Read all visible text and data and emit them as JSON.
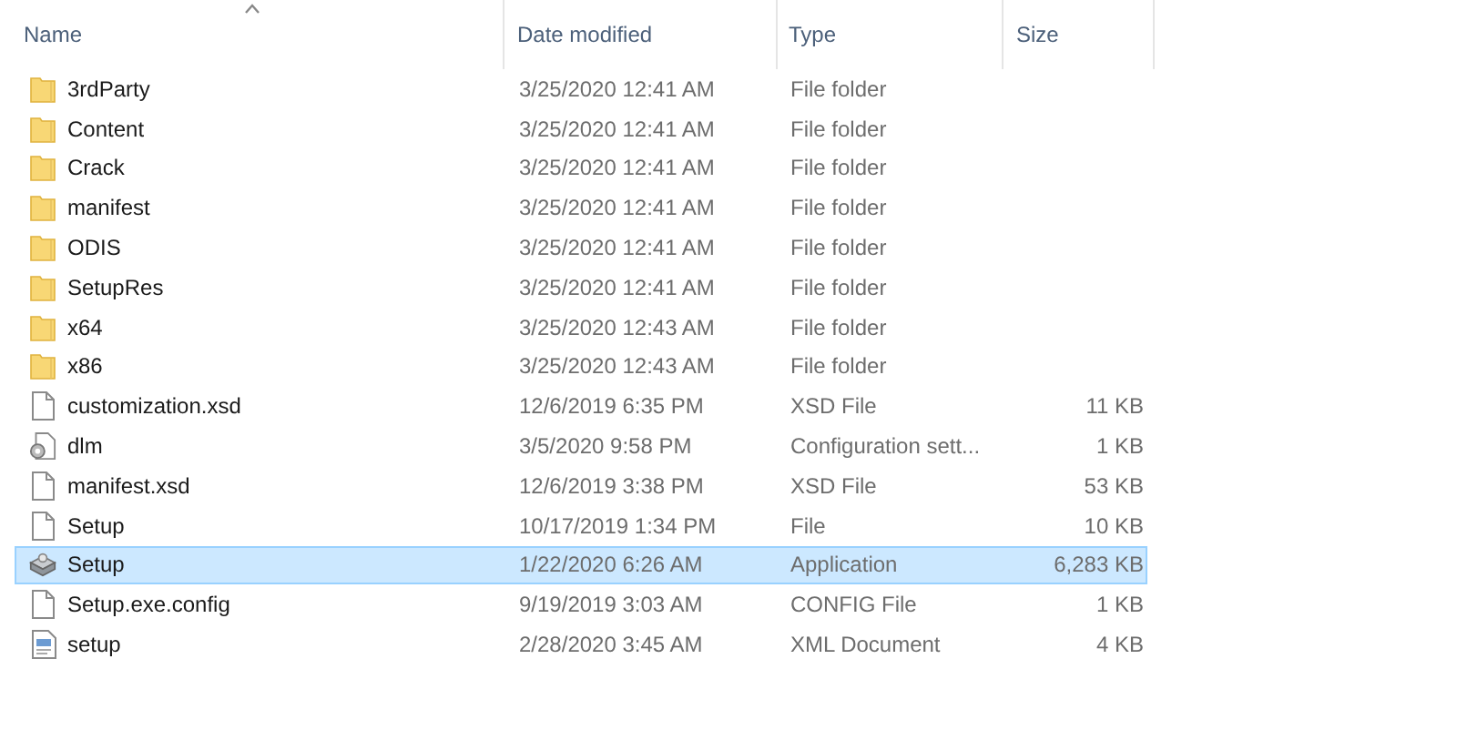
{
  "columns": [
    {
      "label": "Name",
      "sorted": true
    },
    {
      "label": "Date modified",
      "sorted": false
    },
    {
      "label": "Type",
      "sorted": false
    },
    {
      "label": "Size",
      "sorted": false
    }
  ],
  "rows": [
    {
      "kind": "folder",
      "name": "3rdParty",
      "date": "3/25/2020 12:41 AM",
      "type": "File folder",
      "selected": false
    },
    {
      "kind": "folder",
      "name": "Content",
      "date": "3/25/2020 12:41 AM",
      "type": "File folder",
      "selected": false
    },
    {
      "kind": "folder",
      "name": "Crack",
      "date": "3/25/2020 12:41 AM",
      "type": "File folder",
      "selected": false
    },
    {
      "kind": "folder",
      "name": "manifest",
      "date": "3/25/2020 12:41 AM",
      "type": "File folder",
      "selected": false
    },
    {
      "kind": "folder",
      "name": "ODIS",
      "date": "3/25/2020 12:41 AM",
      "type": "File folder",
      "selected": false
    },
    {
      "kind": "folder",
      "name": "SetupRes",
      "date": "3/25/2020 12:41 AM",
      "type": "File folder",
      "selected": false
    },
    {
      "kind": "folder",
      "name": "x64",
      "date": "3/25/2020 12:43 AM",
      "type": "File folder",
      "selected": false
    },
    {
      "kind": "folder",
      "name": "x86",
      "date": "3/25/2020 12:43 AM",
      "type": "File folder",
      "selected": false
    },
    {
      "kind": "file",
      "name": "customization.xsd",
      "date": "12/6/2019 6:35 PM",
      "type": "XSD File",
      "size": "11 KB",
      "selected": false
    },
    {
      "kind": "config",
      "name": "dlm",
      "date": "3/5/2020 9:58 PM",
      "type": "Configuration sett...",
      "size": "1 KB",
      "selected": false
    },
    {
      "kind": "file",
      "name": "manifest.xsd",
      "date": "12/6/2019 3:38 PM",
      "type": "XSD File",
      "size": "53 KB",
      "selected": false
    },
    {
      "kind": "file",
      "name": "Setup",
      "date": "10/17/2019 1:34 PM",
      "type": "File",
      "size": "10 KB",
      "selected": false
    },
    {
      "kind": "application",
      "name": "Setup",
      "date": "1/22/2020 6:26 AM",
      "type": "Application",
      "size": "6,283 KB",
      "selected": true
    },
    {
      "kind": "file",
      "name": "Setup.exe.config",
      "date": "9/19/2019 3:03 AM",
      "type": "CONFIG File",
      "size": "1 KB",
      "selected": false
    },
    {
      "kind": "xml",
      "name": "setup",
      "date": "2/28/2020 3:45 AM",
      "type": "XML Document",
      "size": "4 KB",
      "selected": false
    }
  ]
}
